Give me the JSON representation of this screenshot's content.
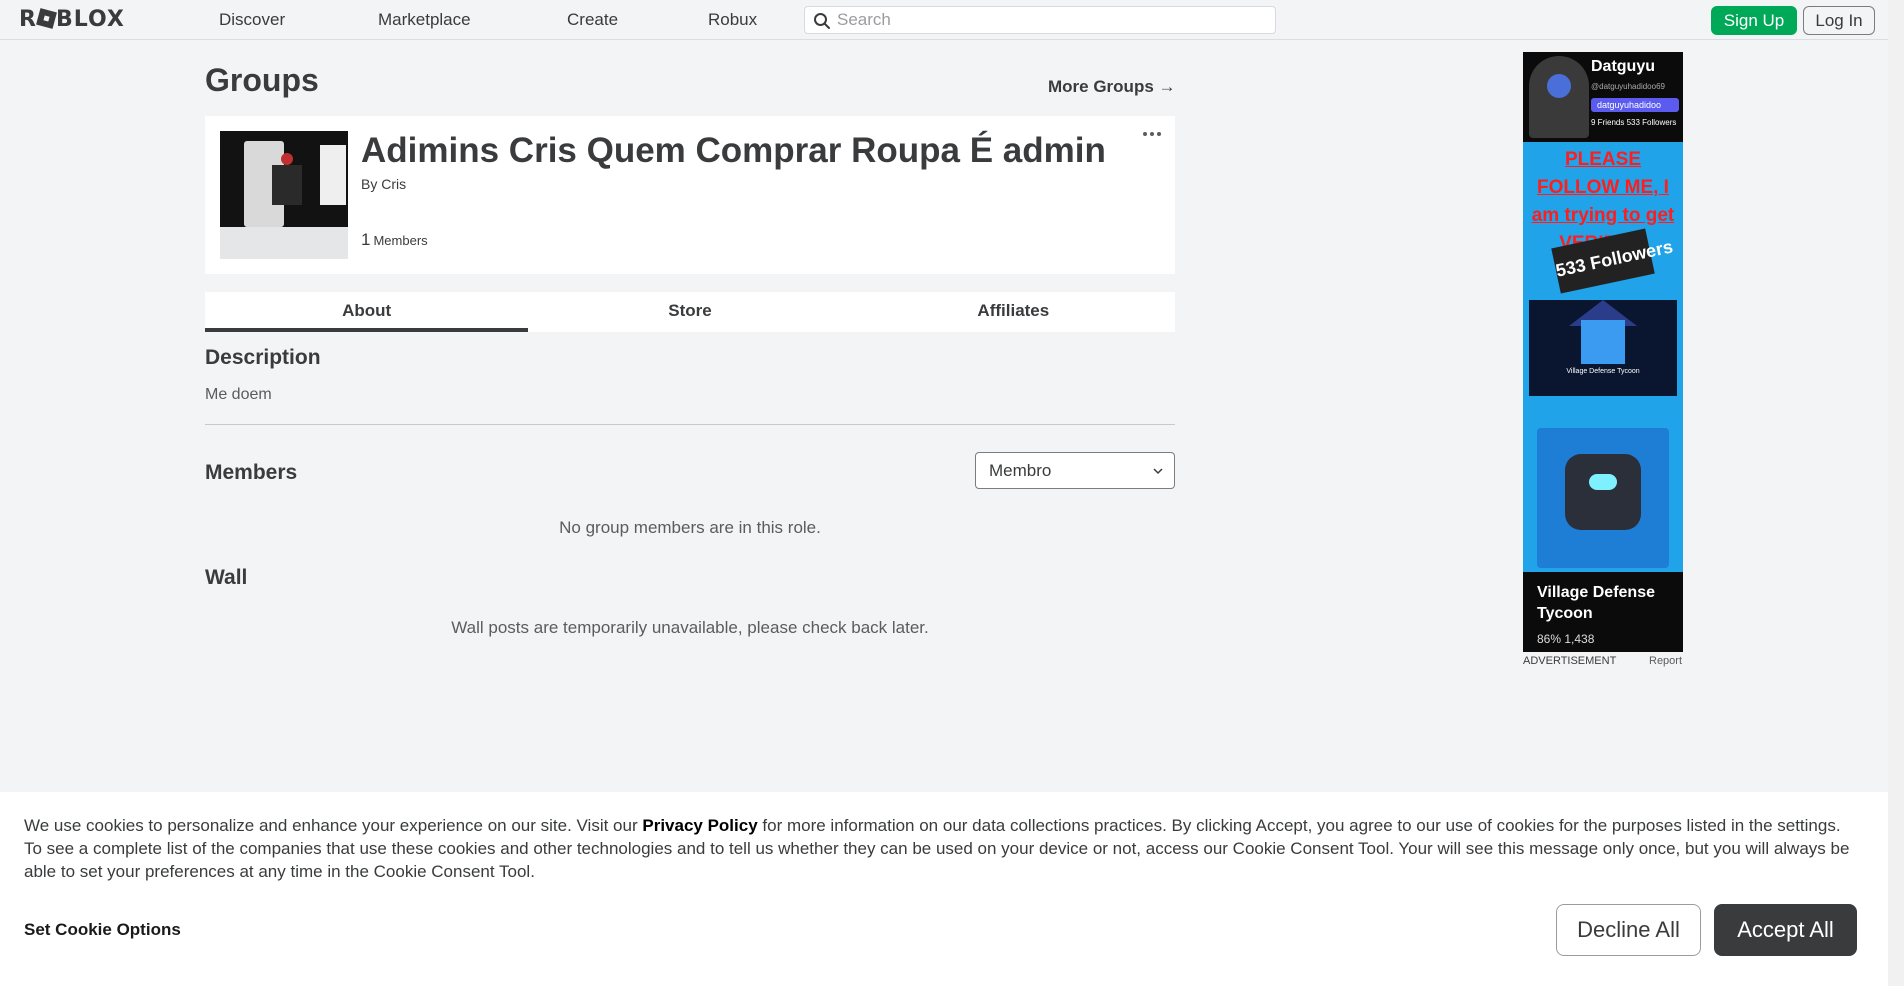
{
  "brand": {
    "logo_text_1": "R",
    "logo_text_2": "BLOX"
  },
  "nav": {
    "links": [
      "Discover",
      "Marketplace",
      "Create",
      "Robux"
    ],
    "search_placeholder": "Search",
    "signup_label": "Sign Up",
    "login_label": "Log In"
  },
  "page": {
    "title": "Groups",
    "more_groups": "More Groups →"
  },
  "group": {
    "name": "Adimins Cris Quem Comprar Roupa É admin",
    "owner": "By Cris",
    "member_count": "1",
    "member_label": "Members"
  },
  "tabs": [
    "About",
    "Store",
    "Affiliates"
  ],
  "about": {
    "description_heading": "Description",
    "description_text": "Me doem",
    "members_heading": "Members",
    "role_selected": "Membro",
    "members_empty": "No group members are in this role.",
    "wall_heading": "Wall",
    "wall_empty": "Wall posts are temporarily unavailable, please check back later."
  },
  "ad": {
    "profile_name": "Datguyu",
    "profile_handle": "@datguyuhadidoo69",
    "profile_badge": "datguyuhadidoo",
    "profile_stats": "9 Friends   533 Followers",
    "follow_text": "PLEASE FOLLOW ME, I am trying to get VERIFIED",
    "followers_card": "533 Followers",
    "mini_caption": "Village Defense Tycoon",
    "game_title": "Village Defense Tycoon",
    "game_stats": "86%   1,438",
    "label": "ADVERTISEMENT",
    "report": "Report"
  },
  "cookie": {
    "text_before": "We use cookies to personalize and enhance your experience on our site. Visit our ",
    "privacy_link": "Privacy Policy",
    "text_after": " for more information on our data collections practices. By clicking Accept, you agree to our use of cookies for the purposes listed in the settings. To see a complete list of the companies that use these cookies and other technologies and to tell us whether they can be used on your device or not, access our Cookie Consent Tool. Your will see this message only once, but you will always be able to set your preferences at any time in the Cookie Consent Tool.",
    "options_label": "Set Cookie Options",
    "decline_label": "Decline All",
    "accept_label": "Accept All"
  },
  "colors": {
    "signup_green": "#00a957",
    "accept_dark": "#393b3d",
    "page_bg": "#f2f4f5"
  }
}
